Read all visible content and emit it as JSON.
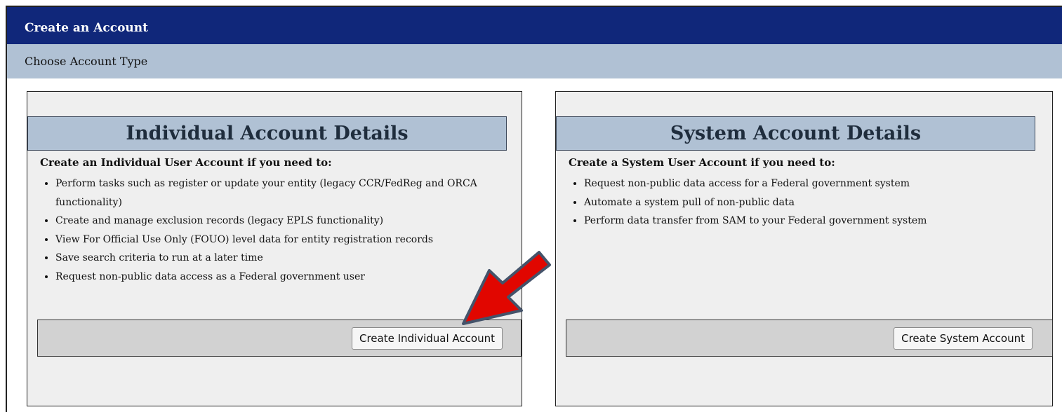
{
  "header": {
    "title": "Create an Account",
    "subtitle": "Choose Account Type"
  },
  "individual": {
    "heading": "Individual Account Details",
    "intro": "Create an Individual User Account if you need to:",
    "items": [
      "Perform tasks such as register or update your entity (legacy CCR/FedReg and ORCA functionality)",
      "Create and manage exclusion records (legacy EPLS functionality)",
      "View For Official Use Only (FOUO) level data for entity registration records",
      "Save search criteria to run at a later time",
      "Request non-public data access as a Federal government user"
    ],
    "button_label": "Create Individual Account"
  },
  "system": {
    "heading": "System Account Details",
    "intro": "Create a System User Account if you need to:",
    "items": [
      "Request non-public data access for a Federal government system",
      "Automate a system pull of non-public data",
      "Perform data transfer from SAM to your Federal government system"
    ],
    "button_label": "Create System Account"
  },
  "annotation": {
    "arrow_color": "#e10600",
    "arrow_outline_color": "#44536a",
    "arrow_icon": "red-arrow-icon"
  }
}
